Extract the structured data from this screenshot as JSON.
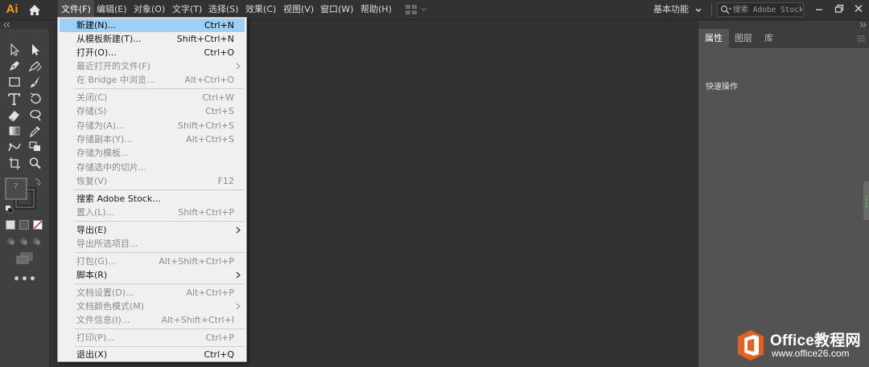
{
  "app": {
    "logo_text": "Ai",
    "accent_color": "#ff9a00"
  },
  "menubar": {
    "items": [
      {
        "label": "文件(F)"
      },
      {
        "label": "编辑(E)"
      },
      {
        "label": "对象(O)"
      },
      {
        "label": "文字(T)"
      },
      {
        "label": "选择(S)"
      },
      {
        "label": "效果(C)"
      },
      {
        "label": "视图(V)"
      },
      {
        "label": "窗口(W)"
      },
      {
        "label": "帮助(H)"
      }
    ],
    "workspace_label": "基本功能",
    "search_placeholder": "搜索 Adobe Stock"
  },
  "file_menu": {
    "highlight_color": "#9cd0f5",
    "items": [
      {
        "label": "新建(N)...",
        "shortcut": "Ctrl+N"
      },
      {
        "label": "从模板新建(T)...",
        "shortcut": "Shift+Ctrl+N"
      },
      {
        "label": "打开(O)...",
        "shortcut": "Ctrl+O"
      },
      {
        "label": "最近打开的文件(F)",
        "shortcut": ""
      },
      {
        "label": "在 Bridge 中浏览...",
        "shortcut": "Alt+Ctrl+O"
      },
      {
        "label": "关闭(C)",
        "shortcut": "Ctrl+W"
      },
      {
        "label": "存储(S)",
        "shortcut": "Ctrl+S"
      },
      {
        "label": "存储为(A)...",
        "shortcut": "Shift+Ctrl+S"
      },
      {
        "label": "存储副本(Y)...",
        "shortcut": "Alt+Ctrl+S"
      },
      {
        "label": "存储为模板...",
        "shortcut": ""
      },
      {
        "label": "存储选中的切片...",
        "shortcut": ""
      },
      {
        "label": "恢复(V)",
        "shortcut": "F12"
      },
      {
        "label": "搜索 Adobe Stock...",
        "shortcut": ""
      },
      {
        "label": "置入(L)...",
        "shortcut": "Shift+Ctrl+P"
      },
      {
        "label": "导出(E)",
        "shortcut": ""
      },
      {
        "label": "导出所选项目...",
        "shortcut": ""
      },
      {
        "label": "打包(G)...",
        "shortcut": "Alt+Shift+Ctrl+P"
      },
      {
        "label": "脚本(R)",
        "shortcut": ""
      },
      {
        "label": "文档设置(D)...",
        "shortcut": "Alt+Ctrl+P"
      },
      {
        "label": "文档颜色模式(M)",
        "shortcut": ""
      },
      {
        "label": "文件信息(I)...",
        "shortcut": "Alt+Shift+Ctrl+I"
      },
      {
        "label": "打印(P)...",
        "shortcut": "Ctrl+P"
      },
      {
        "label": "退出(X)",
        "shortcut": "Ctrl+Q"
      }
    ]
  },
  "toolbar": {
    "fill_stroke_question": "?"
  },
  "right_panel": {
    "tabs": [
      {
        "label": "属性"
      },
      {
        "label": "图层"
      },
      {
        "label": "库"
      }
    ],
    "quick_actions_label": "快速操作"
  },
  "watermark": {
    "brand": "Office教程网",
    "url": "www.office26.com",
    "logo_color": "#e8601c"
  }
}
